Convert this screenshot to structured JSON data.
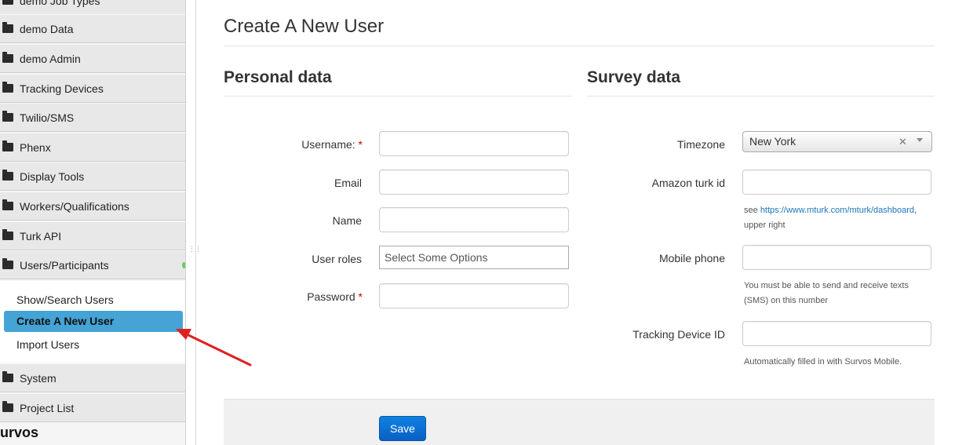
{
  "sidebar": {
    "items": [
      {
        "label": "demo Job Types"
      },
      {
        "label": "demo Data"
      },
      {
        "label": "demo Admin"
      },
      {
        "label": "Tracking Devices"
      },
      {
        "label": "Twilio/SMS"
      },
      {
        "label": "Phenx"
      },
      {
        "label": "Display Tools"
      },
      {
        "label": "Workers/Qualifications"
      },
      {
        "label": "Turk API"
      },
      {
        "label": "Users/Participants"
      }
    ],
    "subitems": {
      "show_search": "Show/Search Users",
      "create_user": "Create A New User",
      "import_users": "Import Users"
    },
    "bottom_items": [
      {
        "label": "System"
      },
      {
        "label": "Project List"
      }
    ],
    "brand": "urvos"
  },
  "page": {
    "title": "Create A New User"
  },
  "personal": {
    "title": "Personal data",
    "username_label": "Username:",
    "email_label": "Email",
    "name_label": "Name",
    "roles_label": "User roles",
    "roles_placeholder": "Select Some Options",
    "password_label": "Password",
    "required_mark": "*"
  },
  "survey": {
    "title": "Survey data",
    "timezone_label": "Timezone",
    "timezone_value": "New York",
    "amazon_label": "Amazon turk id",
    "amazon_help_prefix": "see",
    "amazon_help_link": "https://www.mturk.com/mturk/dashboard",
    "amazon_help_suffix": ",",
    "amazon_help_line2": "upper right",
    "mobile_label": "Mobile phone",
    "mobile_help_line1": "You must be able to send and receive texts",
    "mobile_help_line2": "(SMS) on this number",
    "tracking_label": "Tracking Device ID",
    "tracking_help": "Automatically filled in with Survos Mobile."
  },
  "actions": {
    "save_label": "Save",
    "clear_symbol": "✕"
  },
  "colors": {
    "active_nav": "#45a3d5",
    "primary_button": "#0a6fd6",
    "annotation_arrow": "#e02020"
  }
}
